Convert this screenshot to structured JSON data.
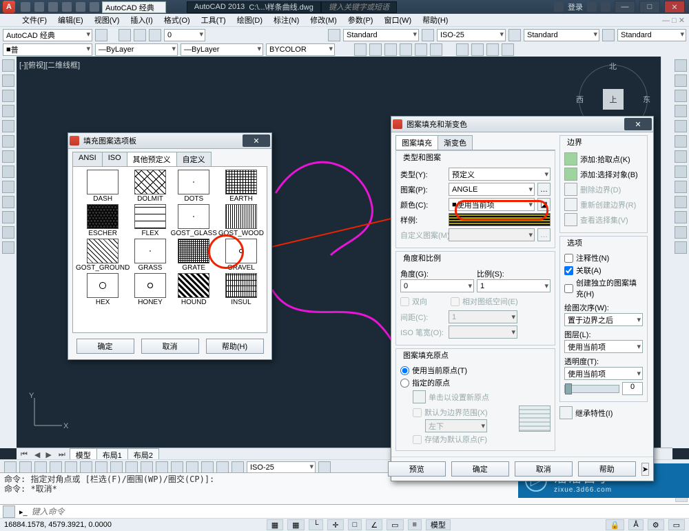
{
  "app": {
    "workspace": "AutoCAD 经典",
    "name": "AutoCAD 2013",
    "doc": "C:\\...\\样条曲线.dwg",
    "search_ph": "键入关键字或短语",
    "login": "登录"
  },
  "menu": [
    "文件(F)",
    "编辑(E)",
    "视图(V)",
    "插入(I)",
    "格式(O)",
    "工具(T)",
    "绘图(D)",
    "标注(N)",
    "修改(M)",
    "参数(P)",
    "窗口(W)",
    "帮助(H)"
  ],
  "props": {
    "workspace_dd": "AutoCAD 经典",
    "zero": "0",
    "layer_sel": "普",
    "linetype_dd1": "ByLayer",
    "linetype_dd2": "ByLayer",
    "color_dd": "BYCOLOR",
    "text_style": "Standard",
    "dim_style": "ISO-25",
    "table_style": "Standard",
    "ml_style": "Standard"
  },
  "view_label": "[-][俯视][二维线框]",
  "viewcube": {
    "n": "北",
    "s": "南",
    "e": "东",
    "w": "西",
    "top": "上"
  },
  "tabs": {
    "model": "模型",
    "layout1": "布局1",
    "layout2": "布局2"
  },
  "status_dim": "ISO-25",
  "cmd": {
    "l1": "命令: 指定对角点或 [栏选(F)/圈围(WP)/圈交(CP)]:",
    "l2": "命令: *取消*",
    "prompt": "键入命令"
  },
  "footer": {
    "coord": "16884.1578, 4579.3921, 0.0000"
  },
  "palette": {
    "title": "填充图案选项板",
    "tabs": [
      "ANSI",
      "ISO",
      "其他预定义",
      "自定义"
    ],
    "patterns": [
      "DASH",
      "DOLMIT",
      "DOTS",
      "EARTH",
      "ESCHER",
      "FLEX",
      "GOST_GLASS",
      "GOST_WOOD",
      "GOST_GROUND",
      "GRASS",
      "GRATE",
      "GRAVEL",
      "HEX",
      "HONEY",
      "HOUND",
      "INSUL"
    ],
    "ok": "确定",
    "cancel": "取消",
    "help": "帮助(H)"
  },
  "hatch": {
    "title": "图案填充和渐变色",
    "tab1": "图案填充",
    "tab2": "渐变色",
    "grp_type": "类型和图案",
    "lbl_type": "类型(Y):",
    "val_type": "预定义",
    "lbl_pat": "图案(P):",
    "val_pat": "ANGLE",
    "lbl_clr": "颜色(C):",
    "val_clr": "使用当前项",
    "lbl_sw": "样例:",
    "lbl_cust": "自定义图案(M):",
    "grp_ang": "角度和比例",
    "lbl_ang": "角度(G):",
    "val_ang": "0",
    "lbl_scale": "比例(S):",
    "val_scale": "1",
    "chk_dbl": "双向",
    "chk_rel": "相对图纸空间(E)",
    "lbl_sp": "间距(C):",
    "val_sp": "1",
    "lbl_iso": "ISO 笔宽(O):",
    "grp_org": "图案填充原点",
    "rad_cur": "使用当前原点(T)",
    "rad_spec": "指定的原点",
    "btn_click": "单击以设置新原点",
    "chk_def": "默认为边界范围(X)",
    "val_def": "左下",
    "chk_store": "存储为默认原点(F)",
    "grp_b": "边界",
    "btn_pick": "添加:拾取点(K)",
    "btn_sel": "添加:选择对象(B)",
    "btn_del": "删除边界(D)",
    "btn_re": "重新创建边界(R)",
    "btn_view": "查看选择集(V)",
    "grp_opt": "选项",
    "chk_annot": "注释性(N)",
    "chk_assoc": "关联(A)",
    "chk_sep": "创建独立的图案填充(H)",
    "lbl_draw": "绘图次序(W):",
    "val_draw": "置于边界之后",
    "lbl_layer": "图层(L):",
    "val_layer": "使用当前项",
    "lbl_trans": "透明度(T):",
    "val_trans": "使用当前项",
    "val_trans_n": "0",
    "btn_inh": "继承特性(I)",
    "preview": "预览",
    "ok": "确定",
    "cancel": "取消",
    "help": "帮助",
    "expand": "▸"
  },
  "wm": {
    "brand": "溜溜自学",
    "sub": "zixue.3d66.com"
  }
}
